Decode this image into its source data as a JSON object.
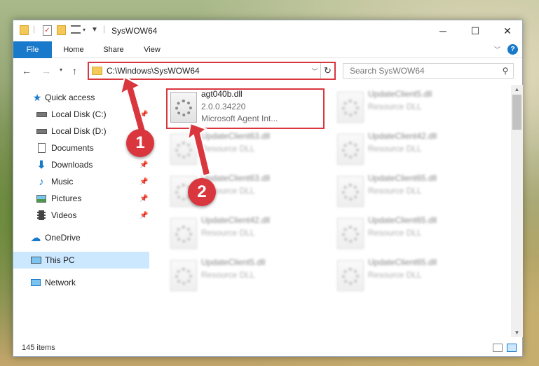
{
  "window": {
    "title": "SysWOW64",
    "controls": {
      "minimize": "─",
      "maximize": "☐",
      "close": "✕"
    }
  },
  "ribbon": {
    "tabs": [
      "File",
      "Home",
      "Share",
      "View"
    ]
  },
  "address": {
    "path": "C:\\Windows\\SysWOW64",
    "search_placeholder": "Search SysWOW64"
  },
  "sidebar": {
    "items": [
      {
        "label": "Quick access",
        "icon": "star-icon",
        "pinned": false
      },
      {
        "label": "Local Disk (C:)",
        "icon": "drive-icon",
        "pinned": true
      },
      {
        "label": "Local Disk (D:)",
        "icon": "drive-icon",
        "pinned": false
      },
      {
        "label": "Documents",
        "icon": "documents-icon",
        "pinned": true
      },
      {
        "label": "Downloads",
        "icon": "download-icon",
        "pinned": true
      },
      {
        "label": "Music",
        "icon": "music-icon",
        "pinned": true
      },
      {
        "label": "Pictures",
        "icon": "pictures-icon",
        "pinned": true
      },
      {
        "label": "Videos",
        "icon": "videos-icon",
        "pinned": true
      },
      {
        "label": "OneDrive",
        "icon": "cloud-icon",
        "pinned": false
      },
      {
        "label": "This PC",
        "icon": "computer-icon",
        "pinned": false,
        "selected": true
      },
      {
        "label": "Network",
        "icon": "network-icon",
        "pinned": false
      }
    ]
  },
  "files": {
    "highlighted": {
      "name": "agt040b.dll",
      "version": "2.0.0.34220",
      "description": "Microsoft Agent Int..."
    },
    "others": [
      {
        "name": "UpdateClient5.dll",
        "type": "Resource DLL"
      },
      {
        "name": "UpdateClient63.dll",
        "type": "Resource DLL"
      },
      {
        "name": "UpdateClient42.dll",
        "type": "Resource DLL"
      },
      {
        "name": "UpdateClient63.dll",
        "type": "Resource DLL"
      },
      {
        "name": "UpdateClient65.dll",
        "type": "Resource DLL"
      },
      {
        "name": "UpdateClient42.dll",
        "type": "Resource DLL"
      },
      {
        "name": "UpdateClient65.dll",
        "type": "Resource DLL"
      },
      {
        "name": "UpdateClient5.dll",
        "type": "Resource DLL"
      },
      {
        "name": "UpdateClient65.dll",
        "type": "Resource DLL"
      }
    ]
  },
  "status": {
    "item_count": "145 items"
  },
  "annotations": {
    "step1": "1",
    "step2": "2"
  },
  "colors": {
    "accent": "#1979ca",
    "annotation_red": "#d9363e",
    "selected_bg": "#cce8ff"
  }
}
